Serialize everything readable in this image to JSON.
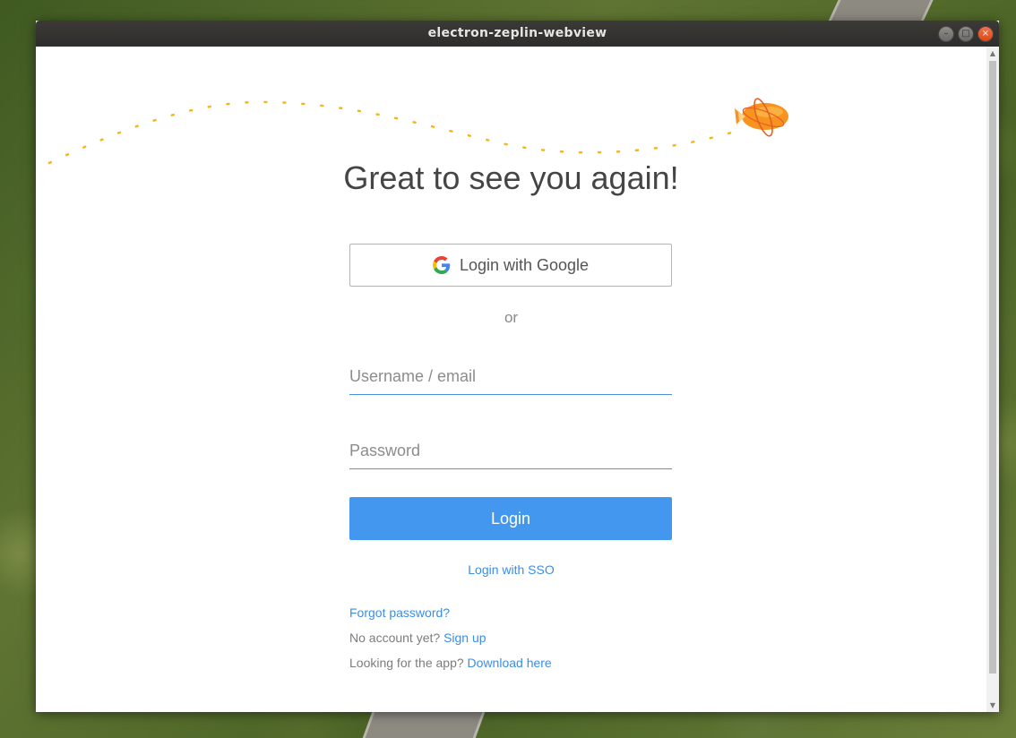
{
  "window": {
    "title": "electron-zeplin-webview",
    "buttons": {
      "minimize": "–",
      "maximize": "□",
      "close": "×"
    }
  },
  "login": {
    "heading": "Great to see you again!",
    "google_button": "Login with Google",
    "or_text": "or",
    "username_placeholder": "Username / email",
    "password_placeholder": "Password",
    "login_button": "Login",
    "sso_link": "Login with SSO",
    "forgot_link": "Forgot password?",
    "no_account_text": "No account yet?",
    "signup_link": "Sign up",
    "looking_text": "Looking for the app?",
    "download_link": "Download here"
  },
  "colors": {
    "accent": "#4497ef",
    "link": "#3a8ee6",
    "trail": "#f5b51b",
    "blimp": "#f7931e"
  },
  "icons": [
    "google-icon",
    "zeplin-blimp-icon"
  ]
}
